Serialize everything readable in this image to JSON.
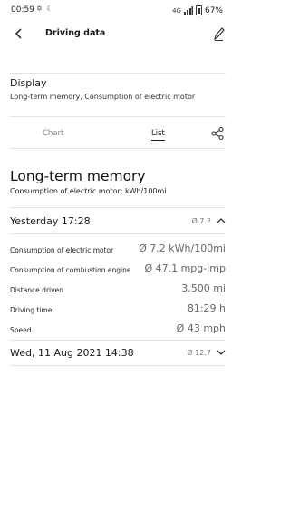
{
  "status_bar": {
    "time": "00:59",
    "left_icons": "✡ ☾",
    "signal": "4G",
    "battery": "67%"
  },
  "app_bar": {
    "title": "Driving data"
  },
  "display": {
    "title": "Display",
    "subtitle": "Long-term memory, Consumption of electric motor"
  },
  "tabs": [
    {
      "label": "Chart",
      "active": false
    },
    {
      "label": "List",
      "active": true
    }
  ],
  "summary": {
    "title": "Long-term memory",
    "subtitle": "Consumption of electric motor: kWh/100mi"
  },
  "entries": [
    {
      "date": "Yesterday 17:28",
      "avg": "Ø 7.2",
      "expanded": true,
      "details": [
        {
          "label": "Consumption of electric motor",
          "value": "Ø 7.2 kWh/100mi"
        },
        {
          "label": "Consumption of combustion engine",
          "value": "Ø 47.1 mpg-imp"
        },
        {
          "label": "Distance driven",
          "value": "3,500 mi"
        },
        {
          "label": "Driving time",
          "value": "81:29 h"
        },
        {
          "label": "Speed",
          "value": "Ø 43 mph"
        }
      ]
    },
    {
      "date": "Wed, 11 Aug 2021 14:38",
      "avg": "Ø 12.7",
      "expanded": false
    }
  ],
  "icons": {
    "back": "back-arrow-icon",
    "edit": "pencil-icon",
    "share": "share-icon",
    "chevron_up": "chevron-up-icon",
    "chevron_down": "chevron-down-icon"
  }
}
